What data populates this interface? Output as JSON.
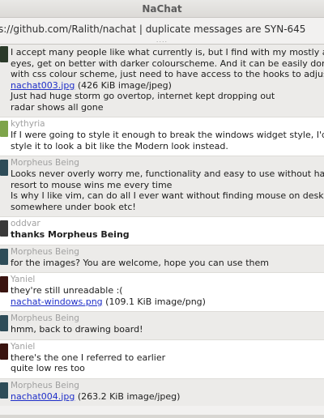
{
  "window": {
    "title": "NaChat"
  },
  "topic": {
    "text": "s://github.com/Ralith/nachat | duplicate messages are SYN-645"
  },
  "colors": {
    "avatar_first": "#2b3a2a",
    "avatar_kythyria": "#7ea44a",
    "avatar_morpheus": "#2e4c58",
    "avatar_oddvar": "#3a3a3a",
    "avatar_yaniel": "#3a1410"
  },
  "messages": [
    {
      "nick": "",
      "avatar_icon": "user-avatar-icon",
      "lines": [
        "I accept many people like what currently is, but I find with my mostly and",
        "eyes, get on better with darker colourscheme. And it can be easily done",
        "with css colour scheme, just need to have access to the hooks to adjust"
      ],
      "file": {
        "name": "nachat003.jpg",
        "meta": "(426 KiB image/jpeg)"
      },
      "after_lines": [
        "Just had huge storm go overtop, internet kept dropping out",
        "radar shows all gone"
      ]
    },
    {
      "nick": "kythyria",
      "lines": [
        "If I were going to style it enough to break the windows widget style, I'd pre",
        "style it to look a bit like the Modern look instead."
      ]
    },
    {
      "nick": "Morpheus Being",
      "lines": [
        "Looks never overly worry me, functionality and easy to use without havin",
        "resort to mouse wins me every time",
        "Is why I like vim, can do all I ever want without finding mouse on desk",
        "somewhere under book etc!"
      ]
    },
    {
      "nick": "oddvar",
      "bold_line": "thanks Morpheus Being"
    },
    {
      "nick": "Morpheus Being",
      "lines": [
        "for the images? You are welcome, hope you can use them"
      ]
    },
    {
      "nick": "Yaniel",
      "lines": [
        "they're still unreadable :("
      ],
      "file": {
        "name": "nachat-windows.png",
        "meta": "(109.1 KiB image/png)"
      }
    },
    {
      "nick": "Morpheus Being",
      "lines": [
        "hmm, back to drawing board!"
      ]
    },
    {
      "nick": "Yaniel",
      "lines": [
        "there's the one I referred to earlier",
        "quite low  res too"
      ]
    },
    {
      "nick": "Morpheus Being",
      "file": {
        "name": "nachat004.jpg",
        "meta": "(263.2 KiB image/jpeg)"
      }
    }
  ]
}
